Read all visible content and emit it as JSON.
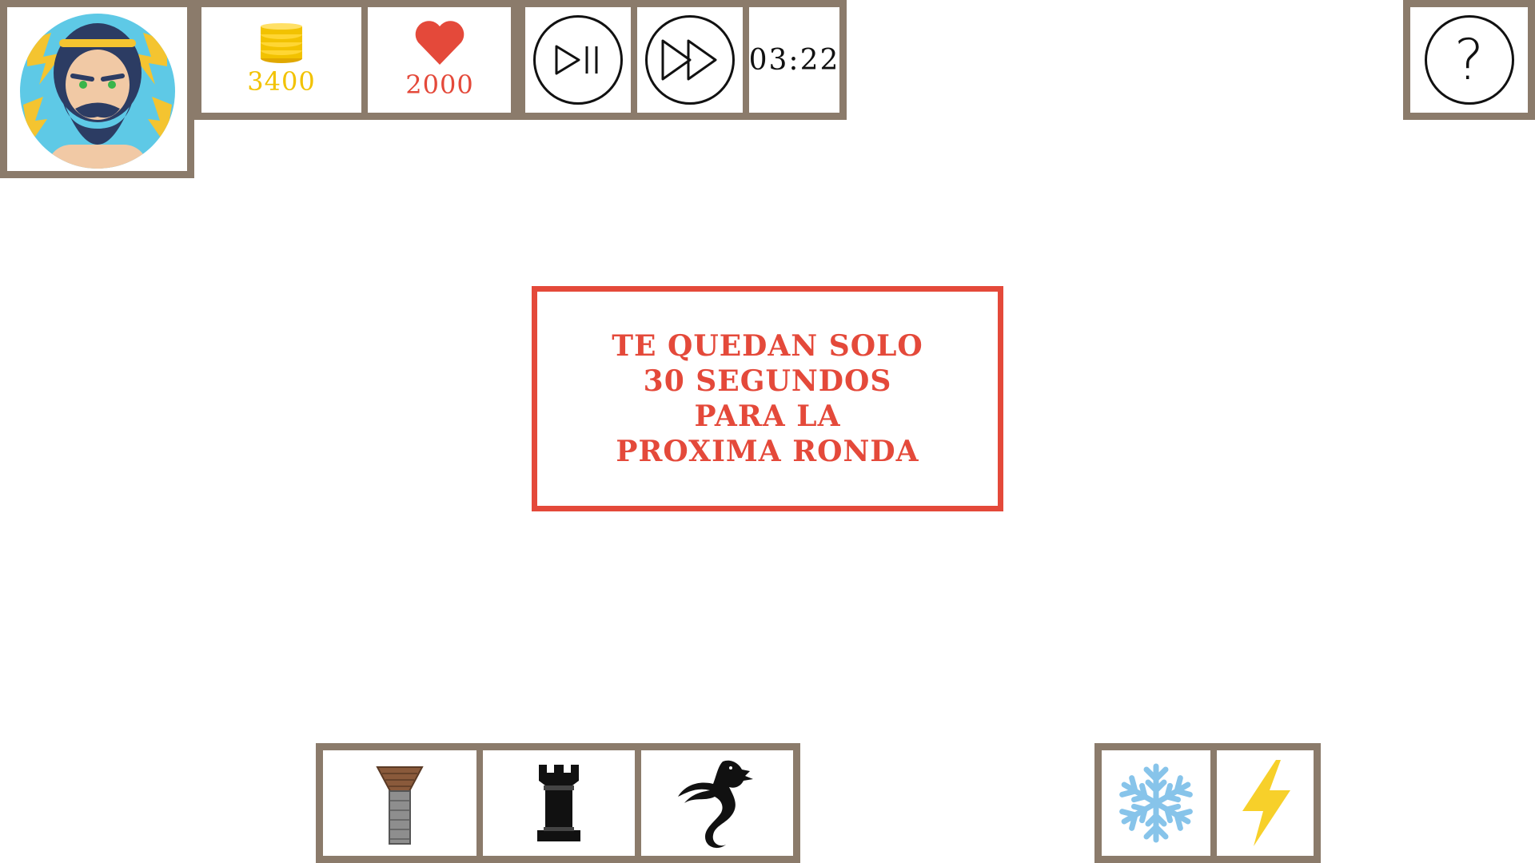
{
  "hud": {
    "avatar": {
      "icon": "zeus-portrait"
    },
    "coins": {
      "icon": "coin-stack-icon",
      "value": "3400",
      "color": "#f2c200"
    },
    "lives": {
      "icon": "heart-icon",
      "value": "2000",
      "color": "#e4493a"
    },
    "controls": {
      "play_pause": {
        "icon": "play-pause-icon"
      },
      "fast_forward": {
        "icon": "fast-forward-icon"
      }
    },
    "timer": "03:22",
    "help": {
      "label": "?"
    }
  },
  "message": {
    "lines": [
      "TE QUEDAN SOLO",
      "30 SEGUNDOS",
      "PARA LA",
      "PROXIMA RONDA"
    ],
    "color": "#e4493a"
  },
  "towers": [
    {
      "icon": "brick-tower-icon"
    },
    {
      "icon": "rook-tower-icon"
    },
    {
      "icon": "dragon-tower-icon"
    }
  ],
  "spells": [
    {
      "icon": "snowflake-icon",
      "color": "#87c4ea"
    },
    {
      "icon": "lightning-icon",
      "color": "#f7d02a"
    }
  ],
  "colors": {
    "frame": "#8b7b6b",
    "accent": "#e4493a",
    "gold": "#f2c200"
  }
}
